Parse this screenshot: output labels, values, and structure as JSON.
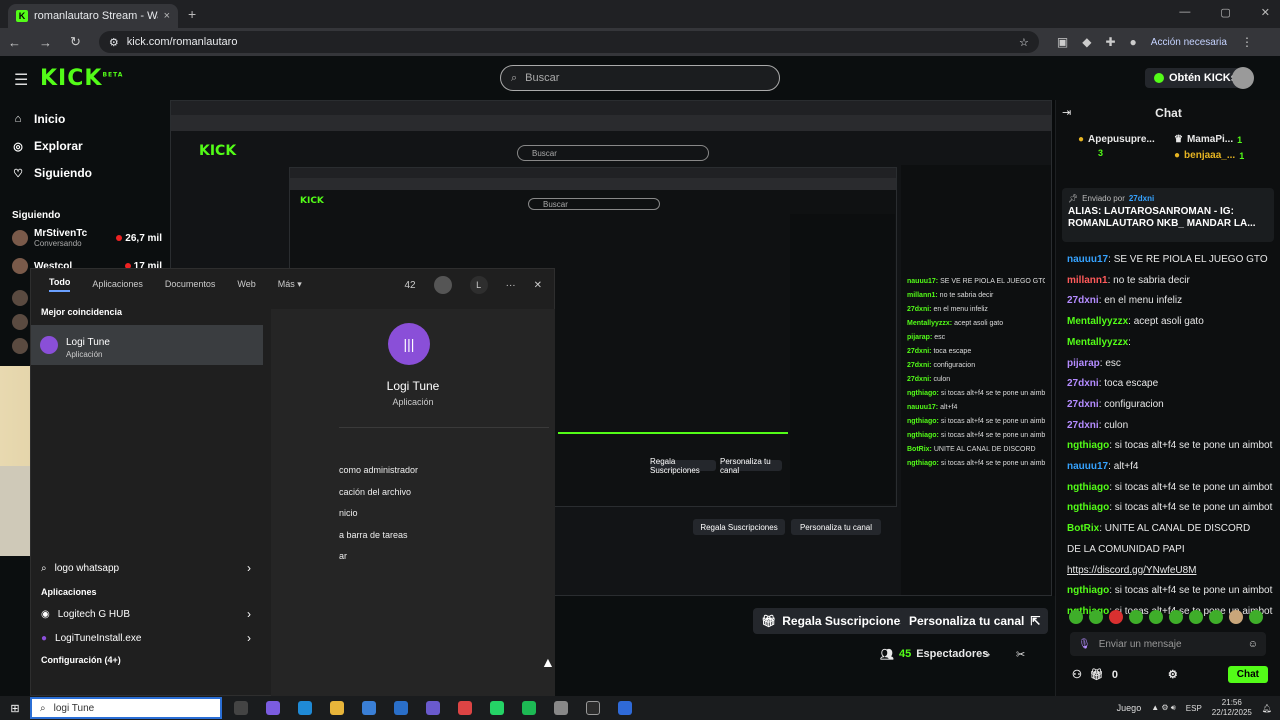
{
  "browser": {
    "tab_title": "romanlautaro Stream - Watch l",
    "tab_close": "×",
    "new_tab": "+",
    "url": "kick.com/romanlautaro",
    "accion": "Acción necesaria",
    "win_min": "—",
    "win_max": "▢",
    "win_close": "✕"
  },
  "header": {
    "logo": "KICK",
    "logo_beta": "BETA",
    "search_placeholder": "Buscar",
    "kicks_button": "Obtén KICKs"
  },
  "sidebar": {
    "items": [
      {
        "icon": "⌂",
        "label": "Inicio"
      },
      {
        "icon": "◎",
        "label": "Explorar"
      },
      {
        "icon": "♡",
        "label": "Siguiendo"
      }
    ],
    "following_title": "Siguiendo",
    "following": [
      {
        "name": "MrStivenTc",
        "category": "Conversando",
        "viewers": "26,7 mil"
      },
      {
        "name": "Westcol",
        "category": "",
        "viewers": "17 mil"
      }
    ]
  },
  "stream": {
    "sub_button": "Regala Suscripciones",
    "custom_button": "Personaliza tu canal",
    "viewers_count": "45",
    "viewers_label": "Espectadores"
  },
  "chat": {
    "title": "Chat",
    "top_left_user": "Apepusupre...",
    "top_left_rank": "1",
    "top_left_count": "3",
    "top_right": [
      {
        "user": "MamaPi...",
        "count": "1"
      },
      {
        "user": "benjaaa_...",
        "count": "1"
      }
    ],
    "pinned_by_label": "Enviado por",
    "pinned_by_user": "27dxni",
    "pinned_text": "ALIAS: LAUTAROSANROMAN - IG: ROMANLAUTARO NKB_ MANDAR LA...",
    "messages": [
      {
        "user": "nauuu17",
        "color": "u-blue",
        "text": "SE VE RE PIOLA EL JUEGO GTO",
        "link": ""
      },
      {
        "user": "millann1",
        "color": "u-red",
        "text": "no te sabria decir",
        "link": ""
      },
      {
        "user": "27dxni",
        "color": "u-purple",
        "text": "en el menu infeliz",
        "link": ""
      },
      {
        "user": "Mentallyyzzx",
        "color": "u-green",
        "text": "acept asoli gato",
        "link": ""
      },
      {
        "user": "Mentallyyzzx",
        "color": "u-green",
        "text": "",
        "link": ""
      },
      {
        "user": "pijarap",
        "color": "u-purple",
        "text": "esc",
        "link": ""
      },
      {
        "user": "27dxni",
        "color": "u-purple",
        "text": "toca escape",
        "link": ""
      },
      {
        "user": "27dxni",
        "color": "u-purple",
        "text": "configuracion",
        "link": ""
      },
      {
        "user": "27dxni",
        "color": "u-purple",
        "text": "culon",
        "link": ""
      },
      {
        "user": "ngthiago",
        "color": "u-green",
        "text": "si tocas alt+f4 se te pone un aimbot",
        "link": ""
      },
      {
        "user": "nauuu17",
        "color": "u-blue",
        "text": "alt+f4",
        "link": ""
      },
      {
        "user": "ngthiago",
        "color": "u-green",
        "text": "si tocas alt+f4 se te pone un aimbot",
        "link": ""
      },
      {
        "user": "ngthiago",
        "color": "u-green",
        "text": "si tocas alt+f4 se te pone un aimbot",
        "link": ""
      },
      {
        "user": "BotRix",
        "color": "u-green",
        "text": "UNITE AL CANAL DE DISCORD",
        "link": ""
      },
      {
        "user": "",
        "color": "",
        "text": "DE LA COMUNIDAD PAPI",
        "link": ""
      },
      {
        "user": "",
        "color": "",
        "text": "",
        "link": "https://discord.gg/YNwfeU8M"
      },
      {
        "user": "ngthiago",
        "color": "u-green",
        "text": "si tocas alt+f4 se te pone un aimbot",
        "link": ""
      },
      {
        "user": "ngthiago",
        "color": "u-green",
        "text": "si tocas alt+f4 se te pone un aimbot",
        "link": ""
      }
    ],
    "input_placeholder": "Enviar un mensaje",
    "bottom_count": "0",
    "send_button": "Chat"
  },
  "search_panel": {
    "tabs": [
      "Todo",
      "Aplicaciones",
      "Documentos",
      "Web",
      "Más ▾"
    ],
    "points": "42",
    "user_initial": "L",
    "more": "···",
    "close": "✕",
    "best_match_title": "Mejor coincidencia",
    "best_match_name": "Logi Tune",
    "best_match_type": "Aplicación",
    "detail_title": "Logi Tune",
    "detail_type": "Aplicación",
    "detail_actions": [
      "como administrador",
      "cación del archivo",
      "nicio",
      "a barra de tareas",
      "ar"
    ],
    "list_web_item": "logo whatsapp",
    "apps_section": "Aplicaciones",
    "apps": [
      "Logitech G HUB",
      "LogiTuneInstall.exe"
    ],
    "config": "Configuración (4+)",
    "query": "logi Tune"
  },
  "taskbar": {
    "game_label": "Juego",
    "lang": "ESP",
    "time": "21:56",
    "date": "22/12/2025"
  }
}
